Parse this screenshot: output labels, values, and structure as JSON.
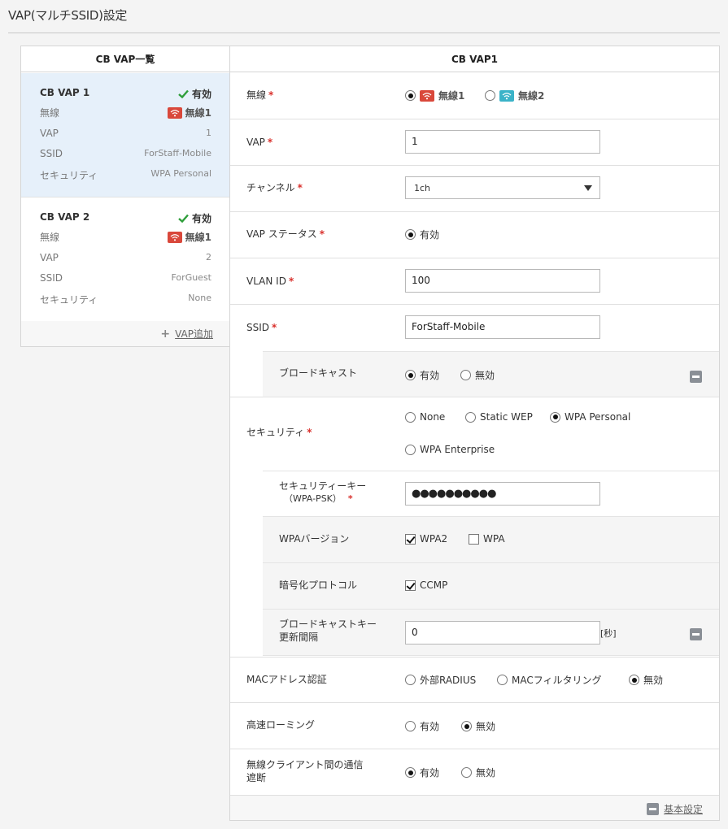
{
  "page": {
    "title": "VAP(マルチSSID)設定"
  },
  "list": {
    "header": "CB VAP一覧",
    "items": [
      {
        "name": "CB VAP 1",
        "status": "有効",
        "radio_label": "無線",
        "radio_value": "無線1",
        "vap_label": "VAP",
        "vap_value": "1",
        "ssid_label": "SSID",
        "ssid_value": "ForStaff-Mobile",
        "security_label": "セキュリティ",
        "security_value": "WPA Personal",
        "selected": true
      },
      {
        "name": "CB VAP 2",
        "status": "有効",
        "radio_label": "無線",
        "radio_value": "無線1",
        "vap_label": "VAP",
        "vap_value": "2",
        "ssid_label": "SSID",
        "ssid_value": "ForGuest",
        "security_label": "セキュリティ",
        "security_value": "None",
        "selected": false
      }
    ],
    "add_label": "VAP追加"
  },
  "form": {
    "header": "CB VAP1",
    "radio": {
      "label": "無線",
      "options": [
        "無線1",
        "無線2"
      ],
      "selected": "無線1"
    },
    "vap": {
      "label": "VAP",
      "value": "1"
    },
    "channel": {
      "label": "チャンネル",
      "value": "1ch"
    },
    "vap_status": {
      "label": "VAP ステータス",
      "option": "有効"
    },
    "vlan": {
      "label": "VLAN ID",
      "value": "100"
    },
    "ssid": {
      "label": "SSID",
      "value": "ForStaff-Mobile"
    },
    "broadcast": {
      "label": "ブロードキャスト",
      "options": [
        "有効",
        "無効"
      ],
      "selected": "有効"
    },
    "security": {
      "label": "セキュリティ",
      "options": [
        "None",
        "Static WEP",
        "WPA Personal",
        "WPA Enterprise"
      ],
      "selected": "WPA Personal"
    },
    "security_key": {
      "label_line1": "セキュリティーキー",
      "label_line2": "（WPA-PSK）",
      "value": "●●●●●●●●●●"
    },
    "wpa_version": {
      "label": "WPAバージョン",
      "options": [
        "WPA2",
        "WPA"
      ],
      "checked": [
        "WPA2"
      ]
    },
    "encryption": {
      "label": "暗号化プロトコル",
      "option": "CCMP"
    },
    "broadcast_key": {
      "label_line1": "ブロードキャストキー",
      "label_line2": "更新間隔",
      "value": "0",
      "unit": "[秒]"
    },
    "mac_auth": {
      "label": "MACアドレス認証",
      "options": [
        "外部RADIUS",
        "MACフィルタリング",
        "無効"
      ],
      "selected": "無効"
    },
    "fast_roaming": {
      "label": "高速ローミング",
      "options": [
        "有効",
        "無効"
      ],
      "selected": "無効"
    },
    "client_isolation": {
      "label_line1": "無線クライアント間の通信",
      "label_line2": "遮断",
      "options": [
        "有効",
        "無効"
      ],
      "selected": "有効"
    },
    "basic_settings_label": "基本設定",
    "required_mark": "*"
  },
  "colors": {
    "wifi1": "#d9483b",
    "wifi2": "#3bb3c8",
    "check": "#2e9e3a",
    "selected_row": "#e6f0fa",
    "required": "#d9302c"
  },
  "icons": {
    "status": "check-icon",
    "wifi": "wifi-icon",
    "add": "plus-icon",
    "collapse": "minus-square-icon"
  }
}
